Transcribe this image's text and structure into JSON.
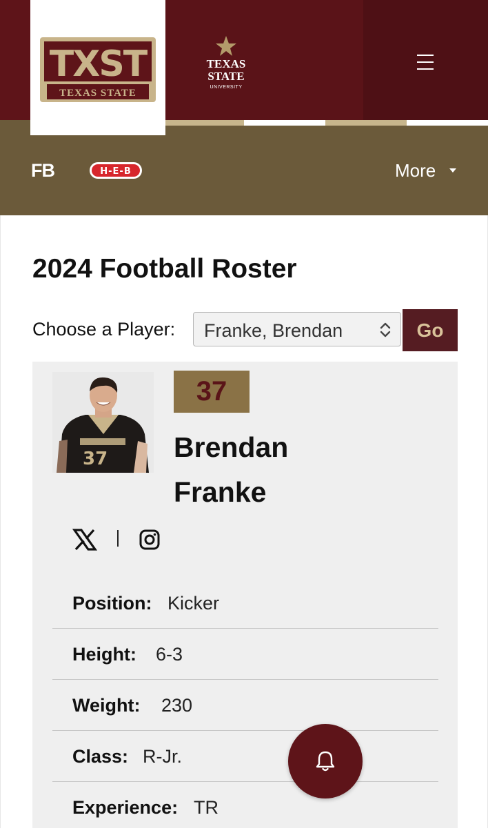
{
  "header": {
    "logo_text": "TXST",
    "logo_subtext": "TEXAS STATE",
    "university_logo_text": [
      "TEXAS",
      "STATE",
      "UNIVERSITY"
    ],
    "menu_icon": "hamburger-menu-icon",
    "colors": {
      "maroon": "#5e1419",
      "gold": "#8a7246",
      "olive": "#6b5a3a"
    }
  },
  "subnav": {
    "sport_label": "FB",
    "sponsor_logo_text": "H-E-B",
    "more_label": "More"
  },
  "main": {
    "page_title": "2024 Football Roster",
    "choose_label": "Choose a Player:",
    "selected_player": "Franke, Brendan",
    "go_label": "Go"
  },
  "player": {
    "number": "37",
    "first_name": "Brendan",
    "last_name": "Franke",
    "social": [
      "x-icon",
      "instagram-icon"
    ],
    "details": [
      {
        "label": "Position:",
        "value": "Kicker"
      },
      {
        "label": "Height:",
        "value": "6-3"
      },
      {
        "label": "Weight:",
        "value": "230"
      },
      {
        "label": "Class:",
        "value": "R-Jr."
      },
      {
        "label": "Experience:",
        "value": "TR"
      }
    ]
  },
  "fab": {
    "icon": "bell-icon"
  }
}
